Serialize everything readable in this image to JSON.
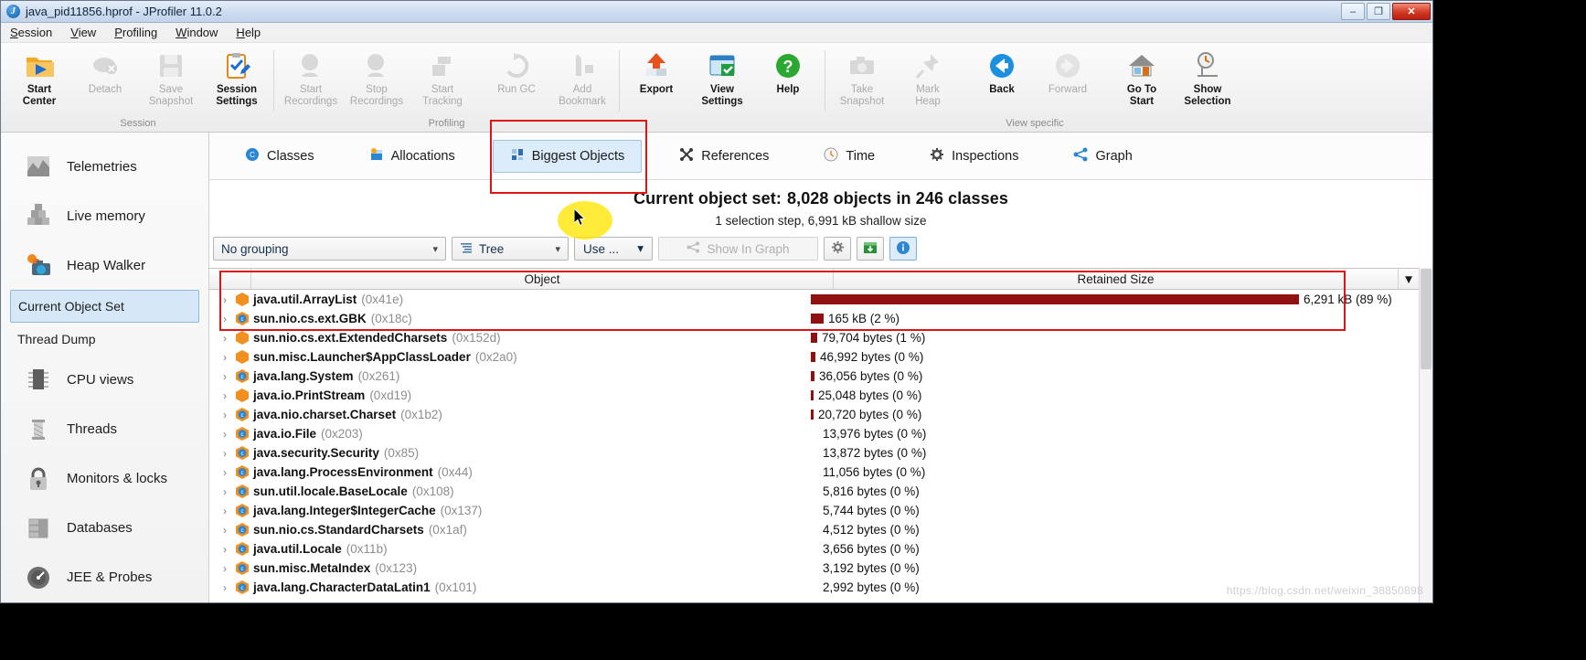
{
  "window": {
    "title": "java_pid11856.hprof - JProfiler 11.0.2",
    "app_icon": "jprofiler-icon",
    "minimize": "–",
    "maximize": "❐",
    "close": "✕"
  },
  "menu": [
    {
      "label": "Session",
      "mnemonic": "S"
    },
    {
      "label": "View",
      "mnemonic": "V"
    },
    {
      "label": "Profiling",
      "mnemonic": "P"
    },
    {
      "label": "Window",
      "mnemonic": "W"
    },
    {
      "label": "Help",
      "mnemonic": "H"
    }
  ],
  "toolbar": {
    "groups": [
      {
        "label": "Session",
        "buttons": [
          {
            "line1": "Start",
            "line2": "Center",
            "icon": "start-center-icon",
            "enabled": true
          },
          {
            "line1": "Detach",
            "line2": "",
            "icon": "detach-icon",
            "enabled": false
          },
          {
            "line1": "Save",
            "line2": "Snapshot",
            "icon": "save-snapshot-icon",
            "enabled": false
          },
          {
            "line1": "Session",
            "line2": "Settings",
            "icon": "session-settings-icon",
            "enabled": true
          }
        ]
      },
      {
        "label": "Profiling",
        "buttons": [
          {
            "line1": "Start",
            "line2": "Recordings",
            "icon": "start-recordings-icon",
            "enabled": false
          },
          {
            "line1": "Stop",
            "line2": "Recordings",
            "icon": "stop-recordings-icon",
            "enabled": false
          },
          {
            "line1": "Start",
            "line2": "Tracking",
            "icon": "start-tracking-icon",
            "enabled": false
          },
          {
            "line1": "Run GC",
            "line2": "",
            "icon": "run-gc-icon",
            "enabled": false
          },
          {
            "line1": "Add",
            "line2": "Bookmark",
            "icon": "add-bookmark-icon",
            "enabled": false
          }
        ]
      },
      {
        "label": "",
        "buttons": [
          {
            "line1": "Export",
            "line2": "",
            "icon": "export-icon",
            "enabled": true
          },
          {
            "line1": "View",
            "line2": "Settings",
            "icon": "view-settings-icon",
            "enabled": true
          },
          {
            "line1": "Help",
            "line2": "",
            "icon": "help-icon",
            "enabled": true
          }
        ]
      },
      {
        "label": "View specific",
        "buttons": [
          {
            "line1": "Take",
            "line2": "Snapshot",
            "icon": "take-snapshot-icon",
            "enabled": false
          },
          {
            "line1": "Mark",
            "line2": "Heap",
            "icon": "mark-heap-icon",
            "enabled": false
          },
          {
            "line1": "Back",
            "line2": "",
            "icon": "back-icon",
            "enabled": true
          },
          {
            "line1": "Forward",
            "line2": "",
            "icon": "forward-icon",
            "enabled": false
          },
          {
            "line1": "Go To",
            "line2": "Start",
            "icon": "go-to-start-icon",
            "enabled": true
          },
          {
            "line1": "Show",
            "line2": "Selection",
            "icon": "show-selection-icon",
            "enabled": true
          }
        ]
      }
    ]
  },
  "sidebar": {
    "items": [
      {
        "label": "Telemetries",
        "icon": "telemetries-icon",
        "type": "top",
        "selected": false
      },
      {
        "label": "Live memory",
        "icon": "live-memory-icon",
        "type": "top",
        "selected": false
      },
      {
        "label": "Heap Walker",
        "icon": "heap-walker-icon",
        "type": "top",
        "selected": false
      },
      {
        "label": "Current Object Set",
        "icon": "",
        "type": "sub",
        "selected": true
      },
      {
        "label": "Thread Dump",
        "icon": "",
        "type": "sub",
        "selected": false
      },
      {
        "label": "CPU views",
        "icon": "cpu-views-icon",
        "type": "top",
        "selected": false
      },
      {
        "label": "Threads",
        "icon": "threads-icon",
        "type": "top",
        "selected": false
      },
      {
        "label": "Monitors & locks",
        "icon": "monitors-locks-icon",
        "type": "top",
        "selected": false
      },
      {
        "label": "Databases",
        "icon": "databases-icon",
        "type": "top",
        "selected": false
      },
      {
        "label": "JEE & Probes",
        "icon": "jee-probes-icon",
        "type": "top",
        "selected": false
      }
    ]
  },
  "main": {
    "tabs": [
      {
        "label": "Classes",
        "icon": "classes-icon",
        "active": false
      },
      {
        "label": "Allocations",
        "icon": "allocations-icon",
        "active": false
      },
      {
        "label": "Biggest Objects",
        "icon": "biggest-objects-icon",
        "active": true
      },
      {
        "label": "References",
        "icon": "references-icon",
        "active": false
      },
      {
        "label": "Time",
        "icon": "time-icon",
        "active": false
      },
      {
        "label": "Inspections",
        "icon": "inspections-icon",
        "active": false
      },
      {
        "label": "Graph",
        "icon": "graph-icon",
        "active": false
      }
    ],
    "headline_lead": "Current object set:",
    "headline_value": "8,028 objects in 246 classes",
    "headline_sub": "1 selection step, 6,991 kB shallow size",
    "controls": {
      "grouping": "No grouping",
      "view_mode": "Tree",
      "view_mode_icon": "tree-icon",
      "use_button": "Use ...",
      "show_in_graph": "Show In Graph",
      "show_in_graph_icon": "graph-small-icon",
      "settings_icon": "gear-icon",
      "export_icon": "export-table-icon",
      "info_icon": "info-icon"
    },
    "table": {
      "columns": [
        "Object",
        "Retained Size"
      ],
      "sort_indicator": "▼",
      "rows": [
        {
          "object": "java.util.ArrayList",
          "id": "(0x41e)",
          "icon": "instance-icon",
          "size": "6,291 kB (89 %)",
          "pct": 89
        },
        {
          "object": "sun.nio.cs.ext.GBK",
          "id": "(0x18c)",
          "icon": "class-icon",
          "size": "165 kB (2 %)",
          "pct": 2.4
        },
        {
          "object": "sun.nio.cs.ext.ExtendedCharsets",
          "id": "(0x152d)",
          "icon": "instance-icon",
          "size": "79,704 bytes (1 %)",
          "pct": 1.2
        },
        {
          "object": "sun.misc.Launcher$AppClassLoader",
          "id": "(0x2a0)",
          "icon": "instance-icon",
          "size": "46,992 bytes (0 %)",
          "pct": 0.85
        },
        {
          "object": "java.lang.System",
          "id": "(0x261)",
          "icon": "class-icon",
          "size": "36,056 bytes (0 %)",
          "pct": 0.65
        },
        {
          "object": "java.io.PrintStream",
          "id": "(0xd19)",
          "icon": "instance-icon",
          "size": "25,048 bytes (0 %)",
          "pct": 0.5
        },
        {
          "object": "java.nio.charset.Charset",
          "id": "(0x1b2)",
          "icon": "class-icon",
          "size": "20,720 bytes (0 %)",
          "pct": 0.45
        },
        {
          "object": "java.io.File",
          "id": "(0x203)",
          "icon": "class-icon",
          "size": "13,976 bytes (0 %)",
          "pct": 0
        },
        {
          "object": "java.security.Security",
          "id": "(0x85)",
          "icon": "class-icon",
          "size": "13,872 bytes (0 %)",
          "pct": 0
        },
        {
          "object": "java.lang.ProcessEnvironment",
          "id": "(0x44)",
          "icon": "class-icon",
          "size": "11,056 bytes (0 %)",
          "pct": 0
        },
        {
          "object": "sun.util.locale.BaseLocale",
          "id": "(0x108)",
          "icon": "class-icon",
          "size": "5,816 bytes (0 %)",
          "pct": 0
        },
        {
          "object": "java.lang.Integer$IntegerCache",
          "id": "(0x137)",
          "icon": "class-icon",
          "size": "5,744 bytes (0 %)",
          "pct": 0
        },
        {
          "object": "sun.nio.cs.StandardCharsets",
          "id": "(0x1af)",
          "icon": "class-icon",
          "size": "4,512 bytes (0 %)",
          "pct": 0
        },
        {
          "object": "java.util.Locale",
          "id": "(0x11b)",
          "icon": "class-icon",
          "size": "3,656 bytes (0 %)",
          "pct": 0
        },
        {
          "object": "sun.misc.MetaIndex",
          "id": "(0x123)",
          "icon": "class-icon",
          "size": "3,192 bytes (0 %)",
          "pct": 0
        },
        {
          "object": "java.lang.CharacterDataLatin1",
          "id": "(0x101)",
          "icon": "class-icon",
          "size": "2,992 bytes (0 %)",
          "pct": 0
        }
      ]
    }
  },
  "watermark": "https://blog.csdn.net/weixin_38850898",
  "colors": {
    "bar": "#8f1111",
    "accent": "#d6e8f7",
    "annotation": "#e01414",
    "highlight": "#ffe600"
  }
}
